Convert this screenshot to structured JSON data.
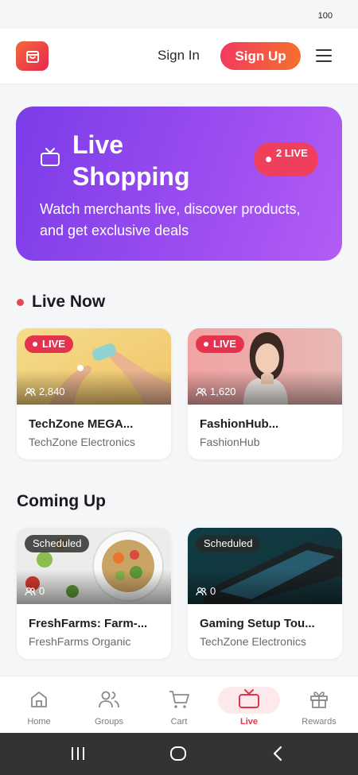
{
  "status_bar": {
    "battery": "100"
  },
  "header": {
    "sign_in": "Sign In",
    "sign_up": "Sign Up"
  },
  "hero": {
    "title": "Live Shopping",
    "live_count": "2 LIVE",
    "subtitle": "Watch merchants live, discover products, and get exclusive deals"
  },
  "sections": {
    "live_now": "Live Now",
    "coming_up": "Coming Up"
  },
  "live_streams": [
    {
      "badge": "LIVE",
      "viewers": "2,840",
      "title": "TechZone MEGA...",
      "merchant": "TechZone Electronics"
    },
    {
      "badge": "LIVE",
      "viewers": "1,620",
      "title": "FashionHub...",
      "merchant": "FashionHub"
    }
  ],
  "upcoming_streams": [
    {
      "badge": "Scheduled",
      "viewers": "0",
      "title": "FreshFarms: Farm-...",
      "merchant": "FreshFarms Organic"
    },
    {
      "badge": "Scheduled",
      "viewers": "0",
      "title": "Gaming Setup Tou...",
      "merchant": "TechZone Electronics"
    }
  ],
  "bottom_nav": [
    {
      "label": "Home",
      "icon": "home-icon",
      "active": false
    },
    {
      "label": "Groups",
      "icon": "users-icon",
      "active": false
    },
    {
      "label": "Cart",
      "icon": "cart-icon",
      "active": false
    },
    {
      "label": "Live",
      "icon": "tv-icon",
      "active": true
    },
    {
      "label": "Rewards",
      "icon": "gift-icon",
      "active": false
    }
  ],
  "colors": {
    "accent": "#e6334d",
    "brand_gradient_start": "#7b3ce8",
    "brand_gradient_end": "#b35cf5",
    "signup_start": "#f23a5e",
    "signup_end": "#f5702f"
  }
}
